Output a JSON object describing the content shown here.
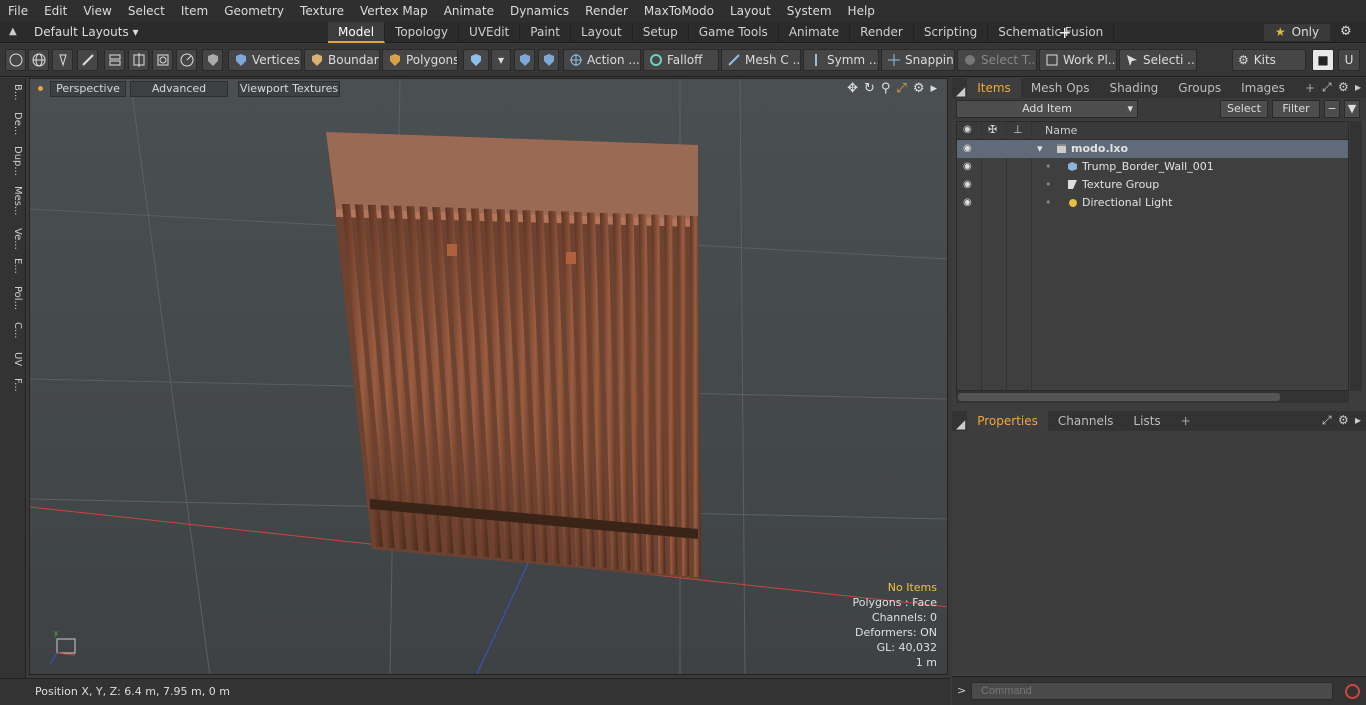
{
  "menu": [
    "File",
    "Edit",
    "View",
    "Select",
    "Item",
    "Geometry",
    "Texture",
    "Vertex Map",
    "Animate",
    "Dynamics",
    "Render",
    "MaxToModo",
    "Layout",
    "System",
    "Help"
  ],
  "layout_selector": "Default Layouts",
  "layout_tabs": [
    "Model",
    "Topology",
    "UVEdit",
    "Paint",
    "Layout",
    "Setup",
    "Game Tools",
    "Animate",
    "Render",
    "Scripting",
    "Schematic Fusion"
  ],
  "active_tab": "Model",
  "only_label": "Only",
  "toolbar": {
    "vertices": "Vertices",
    "boundary": "Boundary",
    "polygons": "Polygons",
    "action": "Action ...",
    "falloff": "Falloff",
    "mesh": "Mesh C ...",
    "symm": "Symm ...",
    "snapping": "Snapping",
    "select_t": "Select T...",
    "work_pl": "Work Pl...",
    "selecti": "Selecti ...",
    "kits": "Kits"
  },
  "left_tabs": [
    "B...",
    "De...",
    "Dup...",
    "Mes...",
    "Ve...",
    "E...",
    "Pol...",
    "C...",
    "UV",
    "F..."
  ],
  "viewport": {
    "perspective": "Perspective",
    "advanced": "Advanced",
    "viewport_textures": "Viewport Textures",
    "stats": {
      "no_items": "No Items",
      "polygons": "Polygons : Face",
      "channels": "Channels: 0",
      "deformers": "Deformers: ON",
      "gl": "GL: 40,032",
      "scale": "1 m"
    }
  },
  "status": "Position X, Y, Z:   6.4 m, 7.95 m, 0 m",
  "items_panel": {
    "tabs": [
      "Items",
      "Mesh Ops",
      "Shading",
      "Groups",
      "Images"
    ],
    "add_item": "Add Item",
    "select": "Select",
    "filter": "Filter",
    "column_name": "Name",
    "scene": "modo.lxo",
    "children": [
      "Trump_Border_Wall_001",
      "Texture Group",
      "Directional Light"
    ]
  },
  "properties_panel": {
    "tabs": [
      "Properties",
      "Channels",
      "Lists"
    ]
  },
  "command_placeholder": "Command",
  "colors": {
    "accent": "#e6a43c",
    "wall": "#8a5238",
    "grid_red": "#c8463c",
    "grid_blue": "#3a55c8"
  }
}
